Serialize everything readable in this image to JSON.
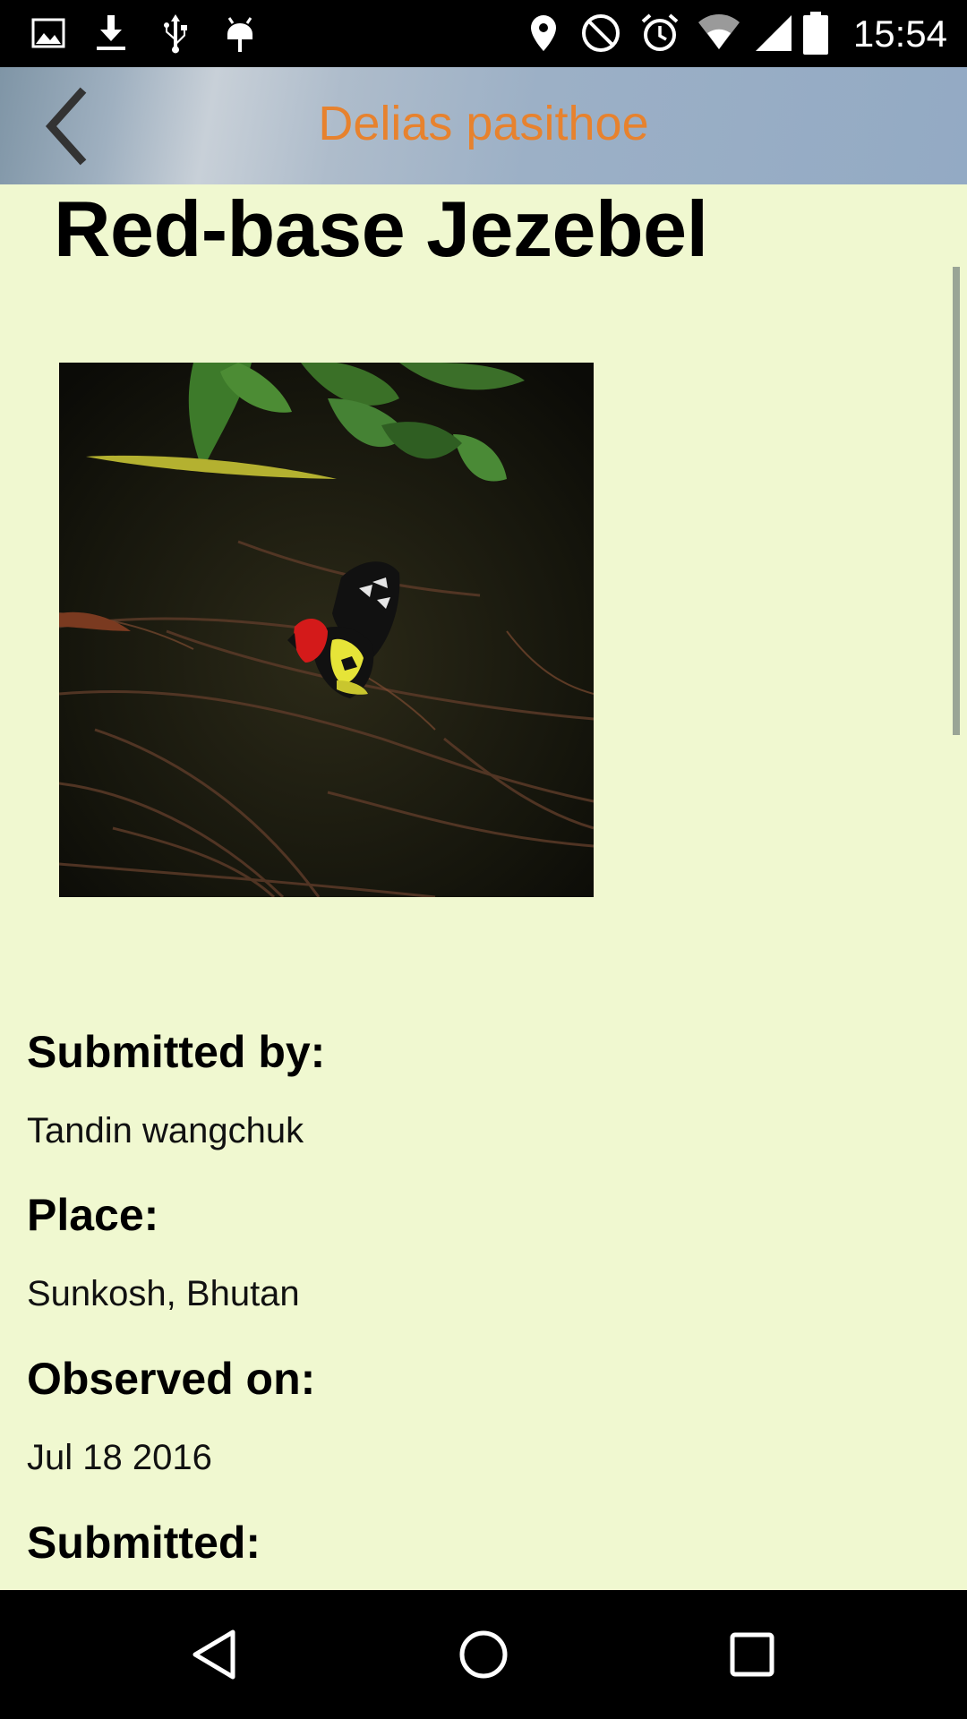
{
  "status_bar": {
    "time": "15:54",
    "left_icons": [
      "image-icon",
      "download-icon",
      "usb-icon",
      "android-debug-icon"
    ],
    "right_icons": [
      "location-icon",
      "do-not-disturb-icon",
      "alarm-icon",
      "wifi-icon",
      "signal-icon",
      "battery-icon"
    ]
  },
  "app_bar": {
    "title": "Delias pasithoe",
    "title_color": "#e7822e",
    "back_icon": "chevron-left-icon"
  },
  "species": {
    "common_name": "Red-base Jezebel"
  },
  "details": {
    "submitted_by_label": "Submitted by:",
    "submitted_by_value": "Tandin wangchuk",
    "place_label": "Place:",
    "place_value": "Sunkosh, Bhutan",
    "observed_on_label": "Observed on:",
    "observed_on_value": "Jul 18 2016",
    "submitted_label": "Submitted:"
  },
  "nav_bar": {
    "back": "back-triangle-icon",
    "home": "home-circle-icon",
    "recents": "recents-square-icon"
  },
  "colors": {
    "background": "#f0f8d0",
    "status_bar": "#000000"
  }
}
